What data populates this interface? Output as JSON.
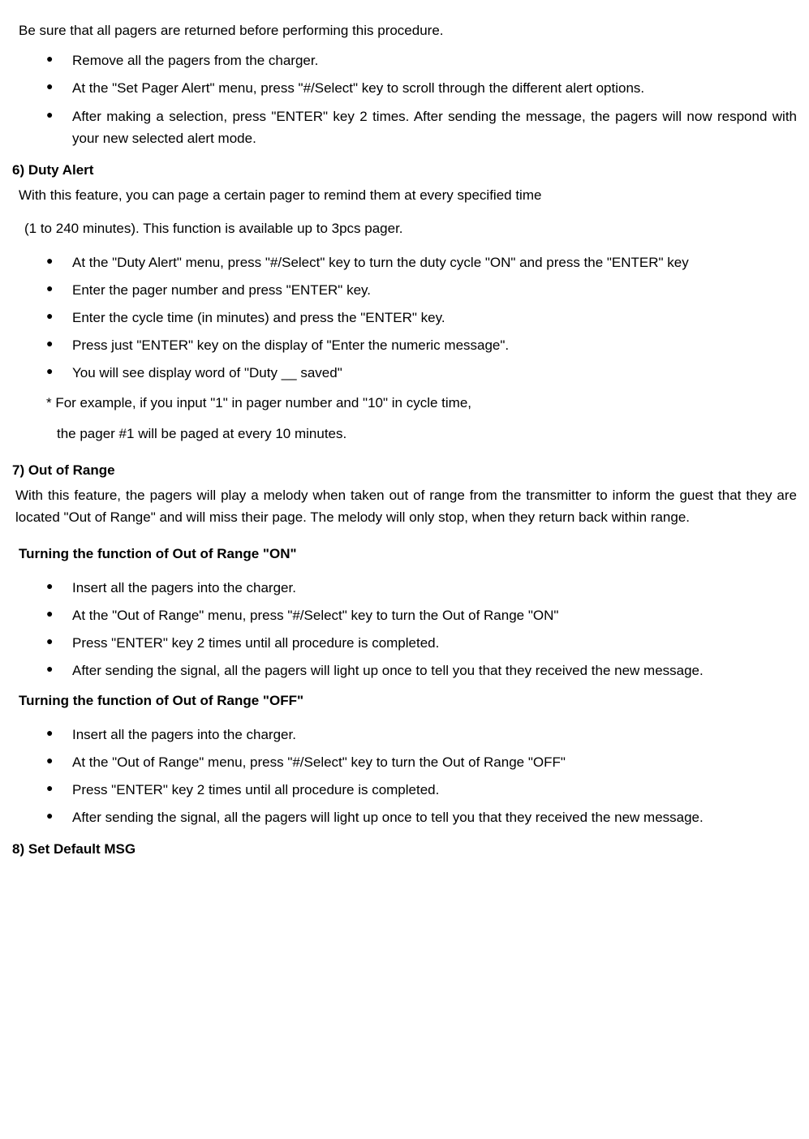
{
  "intro_line": "Be sure that all pagers are returned before performing this procedure.",
  "intro_bullets": [
    "Remove all the pagers from the charger.",
    "At the \"Set Pager Alert\" menu, press \"#/Select\" key to scroll through the different alert options.",
    "After making a selection, press \"ENTER\" key 2 times. After sending the message, the pagers will now respond with your new selected alert mode."
  ],
  "section6": {
    "title": "6)  Duty Alert",
    "p1": "With this feature, you can page a certain pager to remind them at every specified time",
    "p2": "(1 to 240 minutes). This function is available up to 3pcs pager.",
    "bullets": [
      "At the \"Duty Alert\" menu, press \"#/Select\" key to turn the duty cycle \"ON\" and press the \"ENTER\" key",
      "Enter the pager number and press \"ENTER\" key.",
      "Enter the cycle time (in minutes) and press the \"ENTER\" key.",
      "Press just \"ENTER\" key on the display of \"Enter the numeric message\".",
      "You will see display word of \"Duty __ saved\""
    ],
    "note1": "* For example, if you input \"1\" in pager number and \"10\" in cycle time,",
    "note2": "the pager #1 will be paged at every 10 minutes."
  },
  "section7": {
    "title": "7)  Out of Range",
    "p1": "With this feature, the pagers will play a melody when taken out of range from the transmitter to inform the guest that they are located \"Out of Range\" and will miss their page. The melody will only stop, when they return back within range.",
    "sub1": "Turning the function of Out of Range \"ON\"",
    "bullets1": [
      "Insert all the pagers into the charger.",
      "At the \"Out of Range\" menu, press \"#/Select\" key to turn the Out of Range \"ON\"",
      "Press \"ENTER\" key 2 times until all procedure is completed.",
      "After sending the signal, all the pagers will light up once to tell you that they received the new message."
    ],
    "sub2": "Turning the function of Out of Range \"OFF\"",
    "bullets2": [
      "Insert all the pagers into the charger.",
      "At the \"Out of Range\" menu, press \"#/Select\" key to turn the Out of Range \"OFF\"",
      "Press \"ENTER\" key 2 times until all procedure is completed.",
      "After sending the signal, all the pagers will light up once to tell you that they received the new message."
    ]
  },
  "section8": {
    "title": "8)  Set Default MSG"
  }
}
